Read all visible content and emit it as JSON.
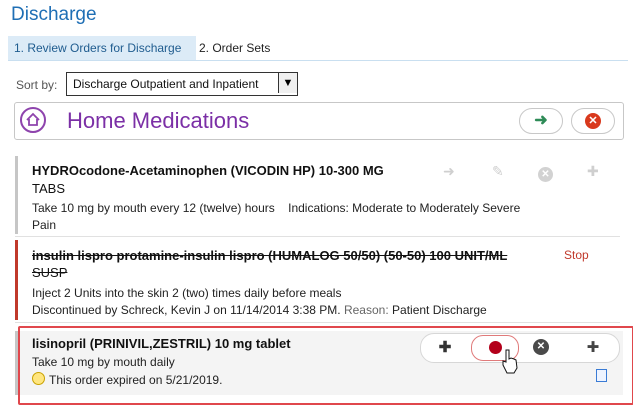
{
  "header": {
    "title": "Discharge"
  },
  "tabs": [
    {
      "label": "1. Review Orders for Discharge",
      "active": true
    },
    {
      "label": "2. Order Sets",
      "active": false
    }
  ],
  "sort": {
    "label": "Sort by:",
    "value": "Discharge Outpatient and Inpatient"
  },
  "section": {
    "title": "Home Medications",
    "go_icon": "arrow-right-icon",
    "close_icon": "close-circle-icon"
  },
  "orders": [
    {
      "name_line1": "HYDROcodone-Acetaminophen (VICODIN HP) 10-300 MG",
      "name_line2": "TABS",
      "sig": "Take 10 mg by mouth every 12 (twelve) hours",
      "indications_label": "Indications:",
      "indications_value": "Moderate to Moderately Severe",
      "indications_cont": "Pain"
    },
    {
      "name_line1": "insulin lispro protamine-insulin lispro (HUMALOG 50/50) (50-50) 100 UNIT/ML",
      "name_line2": "SUSP",
      "status": "Stop",
      "sig": "Inject 2 Units into the skin 2 (two) times daily before meals",
      "disc_text": "Discontinued by Schreck, Kevin J on 11/14/2014 3:38 PM.",
      "reason_label": "Reason:",
      "reason_value": "Patient Discharge",
      "accent": "#c0392b"
    },
    {
      "name": "lisinopril (PRINIVIL,ZESTRIL) 10 mg tablet",
      "sig": "Take 10 mg by mouth daily",
      "expired": "This order expired on 5/21/2019."
    }
  ],
  "colors": {
    "title": "#1f6fb5",
    "section": "#7b2fa6",
    "stop": "#c0392b",
    "highlight": "#e0474c"
  }
}
